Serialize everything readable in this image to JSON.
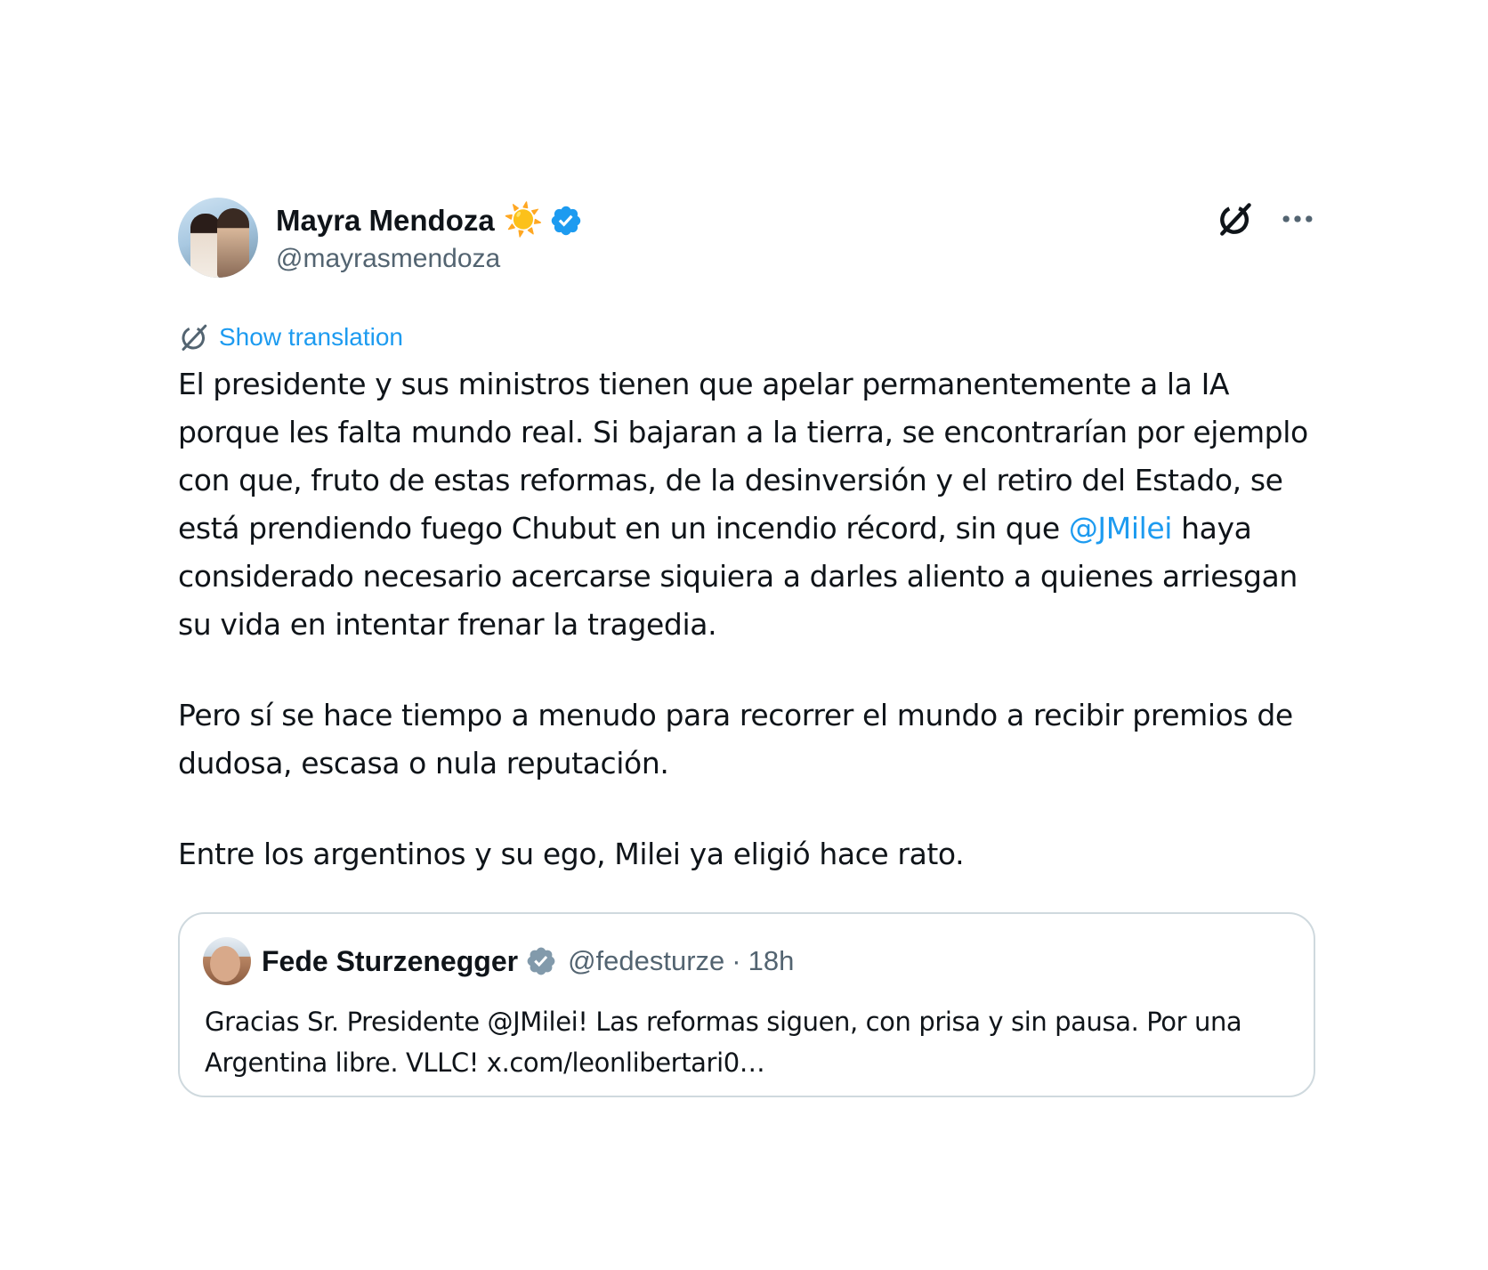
{
  "author": {
    "display_name": "Mayra Mendoza",
    "emoji": "☀️",
    "handle": "@mayrasmendoza",
    "verified": true,
    "avatar": "avatar"
  },
  "actions": {
    "grok_icon": "grok-icon",
    "more_icon": "more-icon"
  },
  "translation": {
    "label": "Show translation"
  },
  "tweet": {
    "p1_before": "El presidente y sus ministros tienen que apelar permanentemente a la IA porque les falta mundo real. Si bajaran a la tierra, se encontrarían por ejemplo con que, fruto de estas reformas, de la desinversión y el retiro del Estado, se está prendiendo fuego Chubut en un incendio récord, sin que ",
    "mention": "@JMilei",
    "p1_after": " haya considerado necesario acercarse siquiera a darles aliento a quienes arriesgan su vida en intentar frenar la tragedia.",
    "p2": "Pero sí se hace tiempo a menudo para recorrer el mundo a recibir premios de dudosa, escasa o nula reputación.",
    "p3": "Entre los argentinos y su ego, Milei ya eligió hace rato."
  },
  "quote": {
    "display_name": "Fede Sturzenegger",
    "verified": true,
    "handle": "@fedesturze",
    "separator": "·",
    "time": "18h",
    "text": "Gracias Sr. Presidente @JMilei! Las reformas siguen, con prisa y sin pausa. Por una Argentina libre. VLLC! x.com/leonlibertari0…"
  },
  "colors": {
    "accent": "#1d9bf0",
    "text": "#0f1419",
    "secondary": "#536471",
    "border": "#cfd9de",
    "verified_gray": "#829aab",
    "sun": "#f5a623"
  }
}
